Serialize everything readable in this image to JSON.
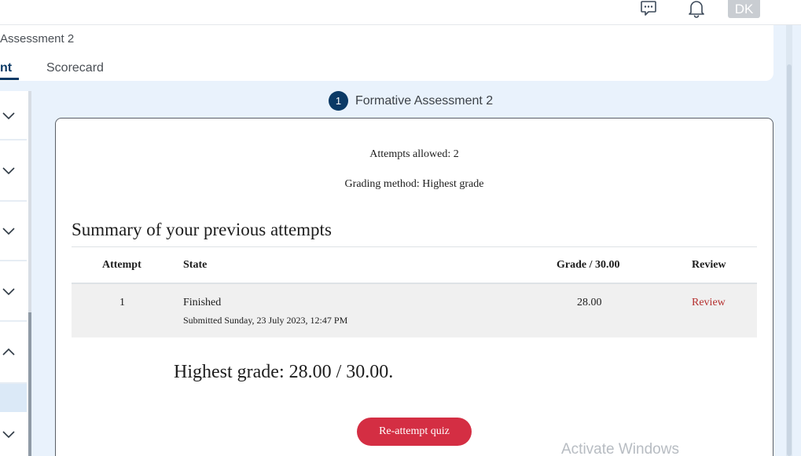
{
  "topbar": {
    "chat_icon": "chat-bubble-icon",
    "bell_icon": "bell-icon",
    "avatar_initials": "DK"
  },
  "header": {
    "course_title": "Assessment 2",
    "tabs": [
      {
        "label": "nt",
        "active": true
      },
      {
        "label": "Scorecard",
        "active": false
      }
    ]
  },
  "sidebar": {
    "items": [
      {
        "icon": "chevron-down-icon"
      },
      {
        "icon": "chevron-down-icon"
      },
      {
        "icon": "chevron-down-icon"
      },
      {
        "icon": "chevron-down-icon"
      },
      {
        "icon": "chevron-up-icon"
      },
      {
        "icon": "chevron-down-icon"
      }
    ]
  },
  "step": {
    "number": "1",
    "label": "Formative Assessment 2"
  },
  "quiz": {
    "attempts_allowed": "Attempts allowed: 2",
    "grading_method": "Grading method: Highest grade",
    "summary_title": "Summary of your previous attempts",
    "table": {
      "headers": [
        "Attempt",
        "State",
        "Grade / 30.00",
        "Review"
      ],
      "rows": [
        {
          "attempt": "1",
          "state": "Finished",
          "submitted": "Submitted Sunday, 23 July 2023, 12:47 PM",
          "grade": "28.00",
          "review": "Review"
        }
      ]
    },
    "highest_grade": "Highest grade: 28.00 / 30.00.",
    "reattempt_label": "Re-attempt quiz"
  },
  "watermark": "Activate Windows",
  "colors": {
    "primary": "#0b3a66",
    "button": "#d42e43",
    "link": "#b5302f",
    "background": "#e9f2fc"
  }
}
